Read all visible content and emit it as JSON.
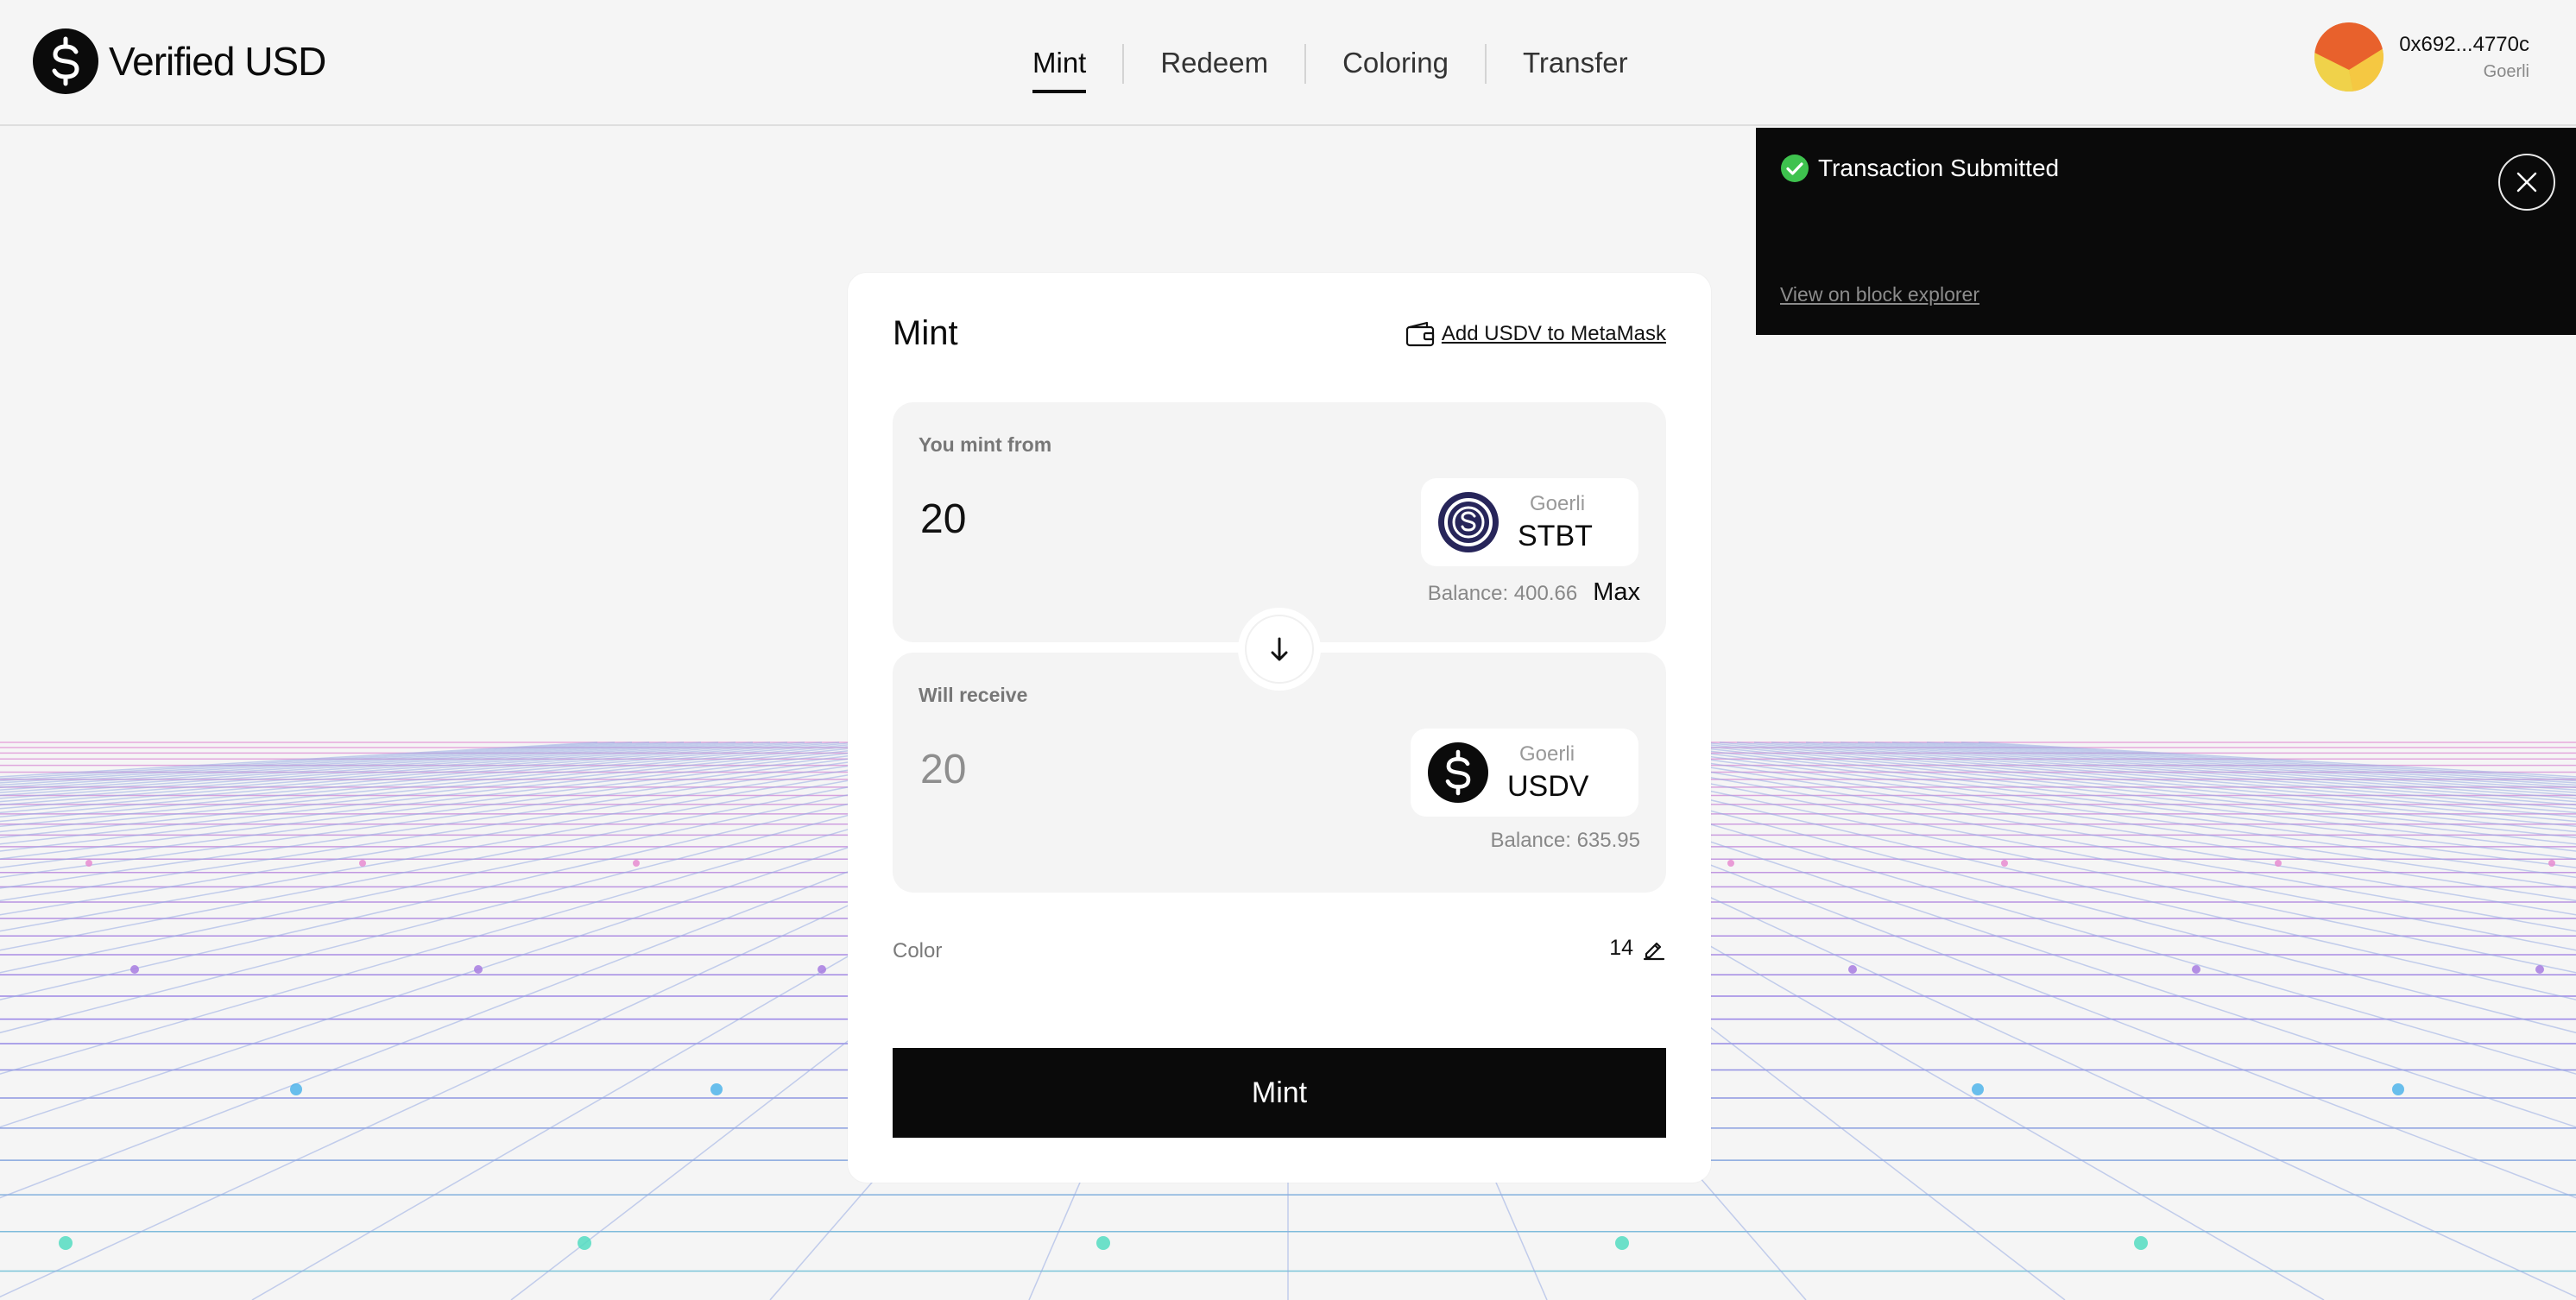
{
  "app": {
    "name": "Verified USD"
  },
  "nav": {
    "items": [
      {
        "label": "Mint",
        "active": true
      },
      {
        "label": "Redeem"
      },
      {
        "label": "Coloring"
      },
      {
        "label": "Transfer"
      }
    ]
  },
  "account": {
    "address": "0x692...4770c",
    "network": "Goerli"
  },
  "toast": {
    "title": "Transaction Submitted",
    "link": "View on block explorer",
    "icon": "check-circle-icon",
    "accent": "#3ec24e"
  },
  "card": {
    "title": "Mint",
    "metamask_link": "Add USDV to MetaMask",
    "from": {
      "label": "You mint from",
      "amount": "20",
      "token": {
        "network": "Goerli",
        "symbol": "STBT"
      },
      "balance": "Balance: 400.66",
      "max_label": "Max"
    },
    "to": {
      "label": "Will receive",
      "amount": "20",
      "token": {
        "network": "Goerli",
        "symbol": "USDV"
      },
      "balance": "Balance: 635.95"
    },
    "color": {
      "label": "Color",
      "value": "14"
    },
    "mint_button": "Mint"
  },
  "colors": {
    "primary": "#0a0a0a",
    "background": "#f5f5f5",
    "toast_bg": "#0a0a0a",
    "success": "#3ec24e"
  }
}
